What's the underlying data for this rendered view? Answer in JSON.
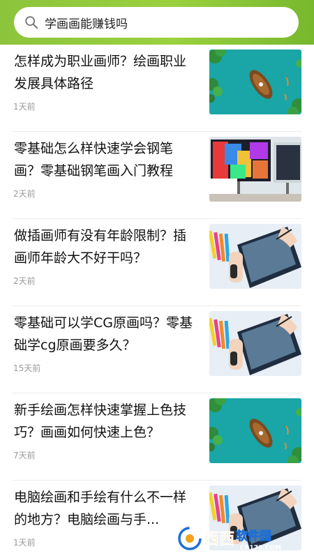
{
  "search": {
    "query": "学画画能赚钱吗",
    "icon": "search-icon"
  },
  "articles": [
    {
      "title": "怎样成为职业画师？绘画职业发展具体路径",
      "time": "1天前",
      "thumb": "boat-lake-image"
    },
    {
      "title": "零基础怎么样快速学会钢笔画？零基础钢笔画入门教程",
      "time": "2天前",
      "thumb": "monitor-desk-image"
    },
    {
      "title": "做插画师有没有年龄限制？插画师年龄大不好干吗？",
      "time": "2天前",
      "thumb": "drawing-tablet-image"
    },
    {
      "title": "零基础可以学CG原画吗？零基础学cg原画要多久？",
      "time": "15天前",
      "thumb": "drawing-tablet-image"
    },
    {
      "title": "新手绘画怎样快速掌握上色技巧？画画如何快速上色？",
      "time": "7天前",
      "thumb": "boat-lake-image"
    },
    {
      "title": "电脑绘画和手绘有什么不一样的地方？电脑绘画与手...",
      "time": "1天前",
      "thumb": "drawing-tablet-image"
    }
  ],
  "watermark": {
    "brand": "西西软件园",
    "domain": "CR173.COM"
  },
  "colors": {
    "header_green": "#8cc43c",
    "time_gray": "#9a9a9a",
    "watermark_blue": "#1d6fd6",
    "watermark_orange": "#f0a21a"
  }
}
